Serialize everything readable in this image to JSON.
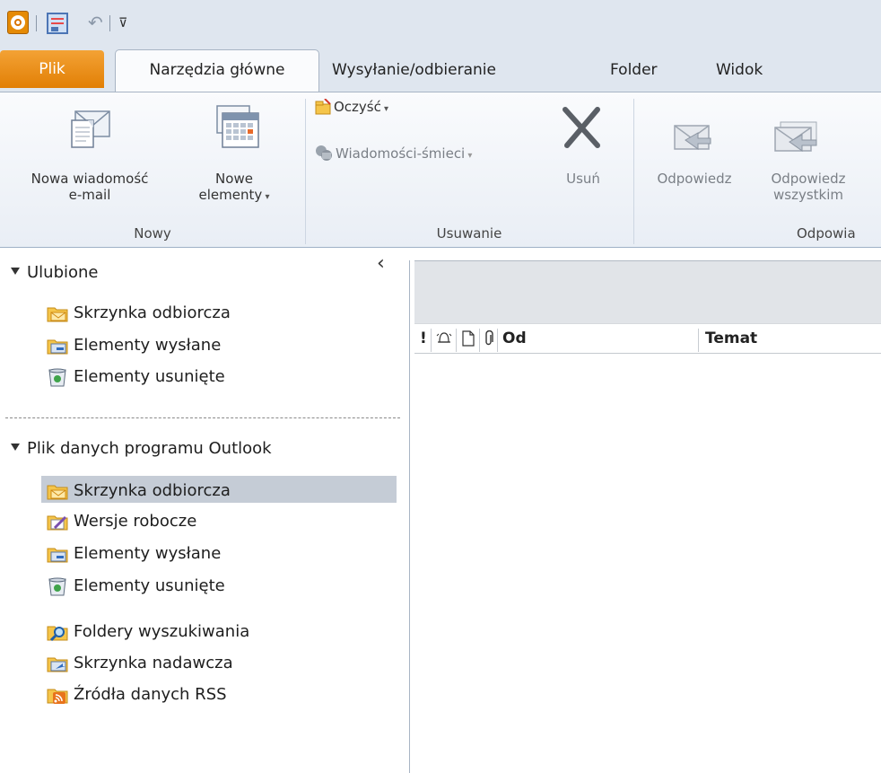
{
  "quick_access": {
    "icons": [
      "outlook-logo-icon",
      "send-receive-all-icon",
      "undo-icon",
      "customize-menu-icon"
    ],
    "menu_glyph": "⊽"
  },
  "tabs": [
    {
      "label": "Plik"
    },
    {
      "label": "Narzędzia główne"
    },
    {
      "label": "Wysyłanie/odbieranie"
    },
    {
      "label": "Folder"
    },
    {
      "label": "Widok"
    }
  ],
  "ribbon": {
    "new_mail_line1": "Nowa wiadomość",
    "new_mail_line2": "e-mail",
    "new_items_line1": "Nowe",
    "new_items_line2": "elementy",
    "group_new": "Nowy",
    "clean_up": "Oczyść",
    "junk": "Wiadomości-śmieci",
    "delete": "Usuń",
    "group_delete": "Usuwanie",
    "reply": "Odpowiedz",
    "reply_all_line1": "Odpowiedz",
    "reply_all_line2": "wszystkim",
    "group_respond": "Odpowia"
  },
  "nav": {
    "favorites_header": "Ulubione",
    "favorites": [
      {
        "label": "Skrzynka odbiorcza",
        "icon": "inbox-folder-icon"
      },
      {
        "label": "Elementy wysłane",
        "icon": "sent-folder-icon"
      },
      {
        "label": "Elementy usunięte",
        "icon": "deleted-items-icon"
      }
    ],
    "datafile_header": "Plik danych programu Outlook",
    "folders": [
      {
        "label": "Skrzynka odbiorcza",
        "icon": "inbox-folder-icon",
        "selected": true
      },
      {
        "label": "Wersje robocze",
        "icon": "drafts-folder-icon"
      },
      {
        "label": "Elementy wysłane",
        "icon": "sent-folder-icon"
      },
      {
        "label": "Elementy usunięte",
        "icon": "deleted-items-icon"
      },
      {
        "label": "Foldery wyszukiwania",
        "icon": "search-folder-icon"
      },
      {
        "label": "Skrzynka nadawcza",
        "icon": "outbox-folder-icon"
      },
      {
        "label": "Źródła danych RSS",
        "icon": "rss-feed-icon"
      }
    ],
    "collapse_glyph": "‹"
  },
  "message_list": {
    "columns": [
      {
        "label": "!",
        "kind": "importance"
      },
      {
        "label": "",
        "kind": "reminder-bell-icon"
      },
      {
        "label": "",
        "kind": "item-type-icon"
      },
      {
        "label": "",
        "kind": "attachment-icon"
      },
      {
        "label": "Od",
        "kind": "from"
      },
      {
        "label": "Temat",
        "kind": "subject"
      }
    ]
  },
  "colors": {
    "file_tab": "#e58a05",
    "tab_strip": "#dfe6ef",
    "selected_folder": "#c5ccd6",
    "folder_yellow": "#f5c54a"
  }
}
